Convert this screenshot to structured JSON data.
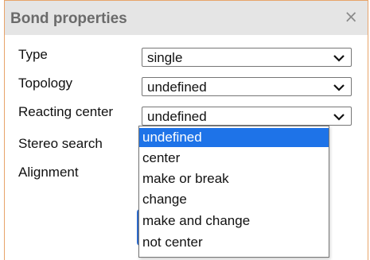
{
  "dialog": {
    "title": "Bond properties",
    "close_glyph": "×",
    "close_icon": "close-icon"
  },
  "fields": [
    {
      "label": "Type",
      "value": "single"
    },
    {
      "label": "Topology",
      "value": "undefined"
    },
    {
      "label": "Reacting center",
      "value": "undefined"
    },
    {
      "label": "Stereo search"
    },
    {
      "label": "Alignment"
    }
  ],
  "dropdown": {
    "options": [
      "undefined",
      "center",
      "make or break",
      "change",
      "make and change",
      "not center"
    ],
    "selected_index": 0
  },
  "colors": {
    "accent": "#1e73e8",
    "border": "#e8a46a",
    "titlebar": "#e5e5e5"
  }
}
